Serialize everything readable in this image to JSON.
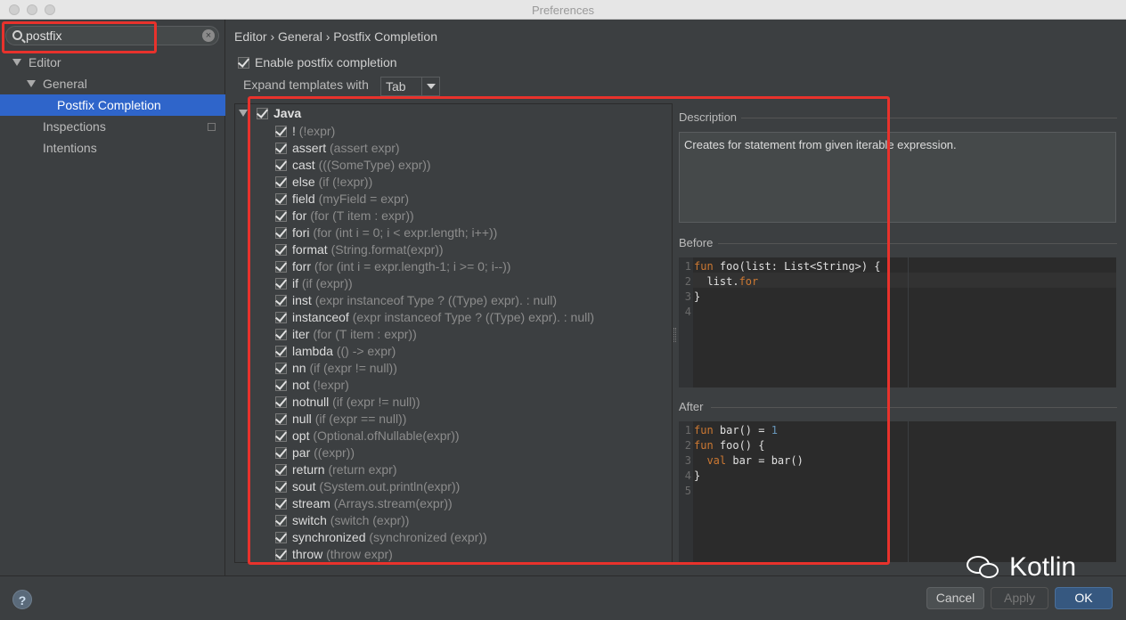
{
  "window": {
    "title": "Preferences"
  },
  "search": {
    "value": "postfix"
  },
  "tree": {
    "editor": "Editor",
    "general": "General",
    "postfix": "Postfix Completion",
    "inspections": "Inspections",
    "intentions": "Intentions"
  },
  "breadcrumb": "Editor › General › Postfix Completion",
  "enable": {
    "label": "Enable postfix completion",
    "checked": true
  },
  "expand": {
    "label": "Expand templates with",
    "value": "Tab"
  },
  "java": {
    "label": "Java"
  },
  "templates": [
    {
      "key": "!",
      "example": "(!expr)"
    },
    {
      "key": "assert",
      "example": "(assert expr)"
    },
    {
      "key": "cast",
      "example": "(((SomeType) expr))"
    },
    {
      "key": "else",
      "example": "(if (!expr))"
    },
    {
      "key": "field",
      "example": "(myField = expr)"
    },
    {
      "key": "for",
      "example": "(for (T item : expr))"
    },
    {
      "key": "fori",
      "example": "(for (int i = 0; i < expr.length; i++))"
    },
    {
      "key": "format",
      "example": "(String.format(expr))"
    },
    {
      "key": "forr",
      "example": "(for (int i = expr.length-1; i >= 0; i--))"
    },
    {
      "key": "if",
      "example": "(if (expr))"
    },
    {
      "key": "inst",
      "example": "(expr instanceof Type ? ((Type) expr). : null)"
    },
    {
      "key": "instanceof",
      "example": "(expr instanceof Type ? ((Type) expr). : null)"
    },
    {
      "key": "iter",
      "example": "(for (T item : expr))"
    },
    {
      "key": "lambda",
      "example": "(() -> expr)"
    },
    {
      "key": "nn",
      "example": "(if (expr != null))"
    },
    {
      "key": "not",
      "example": "(!expr)"
    },
    {
      "key": "notnull",
      "example": "(if (expr != null))"
    },
    {
      "key": "null",
      "example": "(if (expr == null))"
    },
    {
      "key": "opt",
      "example": "(Optional.ofNullable(expr))"
    },
    {
      "key": "par",
      "example": "((expr))"
    },
    {
      "key": "return",
      "example": "(return expr)"
    },
    {
      "key": "sout",
      "example": "(System.out.println(expr))"
    },
    {
      "key": "stream",
      "example": "(Arrays.stream(expr))"
    },
    {
      "key": "switch",
      "example": "(switch (expr))"
    },
    {
      "key": "synchronized",
      "example": "(synchronized (expr))"
    },
    {
      "key": "throw",
      "example": "(throw expr)"
    }
  ],
  "description": {
    "label": "Description",
    "text": "Creates for statement from given iterable expression."
  },
  "before": {
    "label": "Before",
    "lines": [
      {
        "n": "1",
        "parts": [
          {
            "t": "fun",
            "c": "kw"
          },
          {
            "t": " foo(list: List<String>) {",
            "c": "txt"
          }
        ]
      },
      {
        "n": "2",
        "parts": [
          {
            "t": "  list.",
            "c": "txt"
          },
          {
            "t": "for",
            "c": "kw"
          }
        ]
      },
      {
        "n": "3",
        "parts": [
          {
            "t": "}",
            "c": "txt"
          }
        ]
      },
      {
        "n": "4",
        "parts": []
      }
    ]
  },
  "after": {
    "label": "After",
    "lines": [
      {
        "n": "1",
        "parts": [
          {
            "t": "fun",
            "c": "kw"
          },
          {
            "t": " bar() = ",
            "c": "txt"
          },
          {
            "t": "1",
            "c": "numlit"
          }
        ]
      },
      {
        "n": "2",
        "parts": [
          {
            "t": "fun",
            "c": "kw"
          },
          {
            "t": " foo() {",
            "c": "txt"
          }
        ]
      },
      {
        "n": "3",
        "parts": [
          {
            "t": "  val",
            "c": "kw"
          },
          {
            "t": " bar = bar()",
            "c": "txt"
          }
        ]
      },
      {
        "n": "4",
        "parts": [
          {
            "t": "}",
            "c": "txt"
          }
        ]
      },
      {
        "n": "5",
        "parts": []
      }
    ]
  },
  "buttons": {
    "help": "?",
    "cancel": "Cancel",
    "apply": "Apply",
    "ok": "OK"
  },
  "watermark": {
    "text": "Kotlin"
  },
  "colors": {
    "selection": "#2f65ca",
    "highlight_box": "#e8322c",
    "keyword": "#cc7832",
    "ok_button": "#365880"
  }
}
